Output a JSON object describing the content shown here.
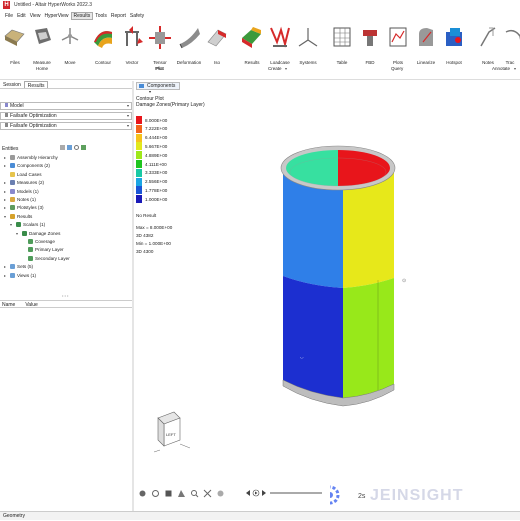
{
  "window": {
    "title": "Untitled - Altair HyperWorks 2022.3",
    "logo_letter": "H"
  },
  "menu": [
    "File",
    "Edit",
    "View",
    "HyperView",
    "Results",
    "Tools",
    "Report",
    "Safety"
  ],
  "menu_active": "Results",
  "ribbon": {
    "buttons": [
      {
        "label": "Files"
      },
      {
        "label": "Measure"
      },
      {
        "label": "Move"
      },
      {
        "label": "Contour"
      },
      {
        "label": "Vector"
      },
      {
        "label": "Tensor\nPlot"
      },
      {
        "label": "Deformation"
      },
      {
        "label": "Iso"
      },
      {
        "label": "Results"
      },
      {
        "label": "Loadcase"
      },
      {
        "label": "Systems"
      },
      {
        "label": "Table"
      },
      {
        "label": "FBD"
      },
      {
        "label": "Plots"
      },
      {
        "label": "Linearize"
      },
      {
        "label": "Hotspot"
      },
      {
        "label": "Notes"
      },
      {
        "label": "Trac"
      }
    ],
    "groups": {
      "home": "Home",
      "plot": "Plot",
      "create": "Create",
      "query": "Query",
      "annotate": "Annotate"
    }
  },
  "left_panel": {
    "tabs": [
      "Session",
      "Results"
    ],
    "active_tab": "Results",
    "selectors": [
      "Model",
      "Failsafe Optimization",
      "Failsafe Optimization"
    ],
    "entities_label": "Entities",
    "tree": [
      {
        "label": "Assembly Hierarchy",
        "level": 0,
        "exp": "▸",
        "color": "#9a9a9a"
      },
      {
        "label": "Components (2)",
        "level": 0,
        "exp": "▸",
        "color": "#4a8cd6"
      },
      {
        "label": "Load Cases",
        "level": 0,
        "exp": "",
        "color": "#e6c44c"
      },
      {
        "label": "Measures (2)",
        "level": 0,
        "exp": "▸",
        "color": "#6b7fb0"
      },
      {
        "label": "Models (1)",
        "level": 0,
        "exp": "▸",
        "color": "#8888cc"
      },
      {
        "label": "Notes (1)",
        "level": 0,
        "exp": "▸",
        "color": "#d9a941"
      },
      {
        "label": "Plotstyles (3)",
        "level": 0,
        "exp": "▸",
        "color": "#5e9b5e"
      },
      {
        "label": "Results",
        "level": 0,
        "exp": "▾",
        "color": "#d6a22b"
      },
      {
        "label": "Scalars (1)",
        "level": 1,
        "exp": "▾",
        "color": "#3a8c4a"
      },
      {
        "label": "Damage Zones",
        "level": 2,
        "exp": "▾",
        "color": "#3a8c4a"
      },
      {
        "label": "Coverage",
        "level": 3,
        "exp": "",
        "color": "#4f9c5a"
      },
      {
        "label": "Primary Layer",
        "level": 3,
        "exp": "",
        "color": "#4f9c5a"
      },
      {
        "label": "Secondary Layer",
        "level": 3,
        "exp": "",
        "color": "#4f9c5a"
      },
      {
        "label": "Sets (5)",
        "level": 0,
        "exp": "▸",
        "color": "#6a9fd6"
      },
      {
        "label": "Views (1)",
        "level": 0,
        "exp": "▸",
        "color": "#6a9fd6"
      }
    ],
    "name_col": "Name",
    "value_col": "Value"
  },
  "viewport": {
    "dropdown": "Components",
    "legend": {
      "title": "Contour Plot",
      "subtitle": "Damage Zones(Primary Layer)",
      "levels": [
        {
          "value": "8.000E+00",
          "color": "#e8151b"
        },
        {
          "value": "7.222E+00",
          "color": "#f2641c"
        },
        {
          "value": "6.444E+00",
          "color": "#f6c21a"
        },
        {
          "value": "5.667E+00",
          "color": "#e2e81c"
        },
        {
          "value": "4.889E+00",
          "color": "#9ee81a"
        },
        {
          "value": "4.111E+00",
          "color": "#1ec51e"
        },
        {
          "value": "3.333E+00",
          "color": "#19c9a4"
        },
        {
          "value": "2.556E+00",
          "color": "#1ba6e4"
        },
        {
          "value": "1.778E+00",
          "color": "#1a55d6"
        },
        {
          "value": "1.000E+00",
          "color": "#1a1ab8"
        }
      ],
      "no_result": "No Result",
      "max": "Max = 8.000E+00",
      "max_id": "3D 4382",
      "min": "Min = 1.000E+00",
      "min_id": "3D 4300"
    },
    "cube_label": "LEFT"
  },
  "statusbar": {
    "text": "Geometry"
  },
  "watermark": "JEINSIGHT",
  "play_value": "2s"
}
